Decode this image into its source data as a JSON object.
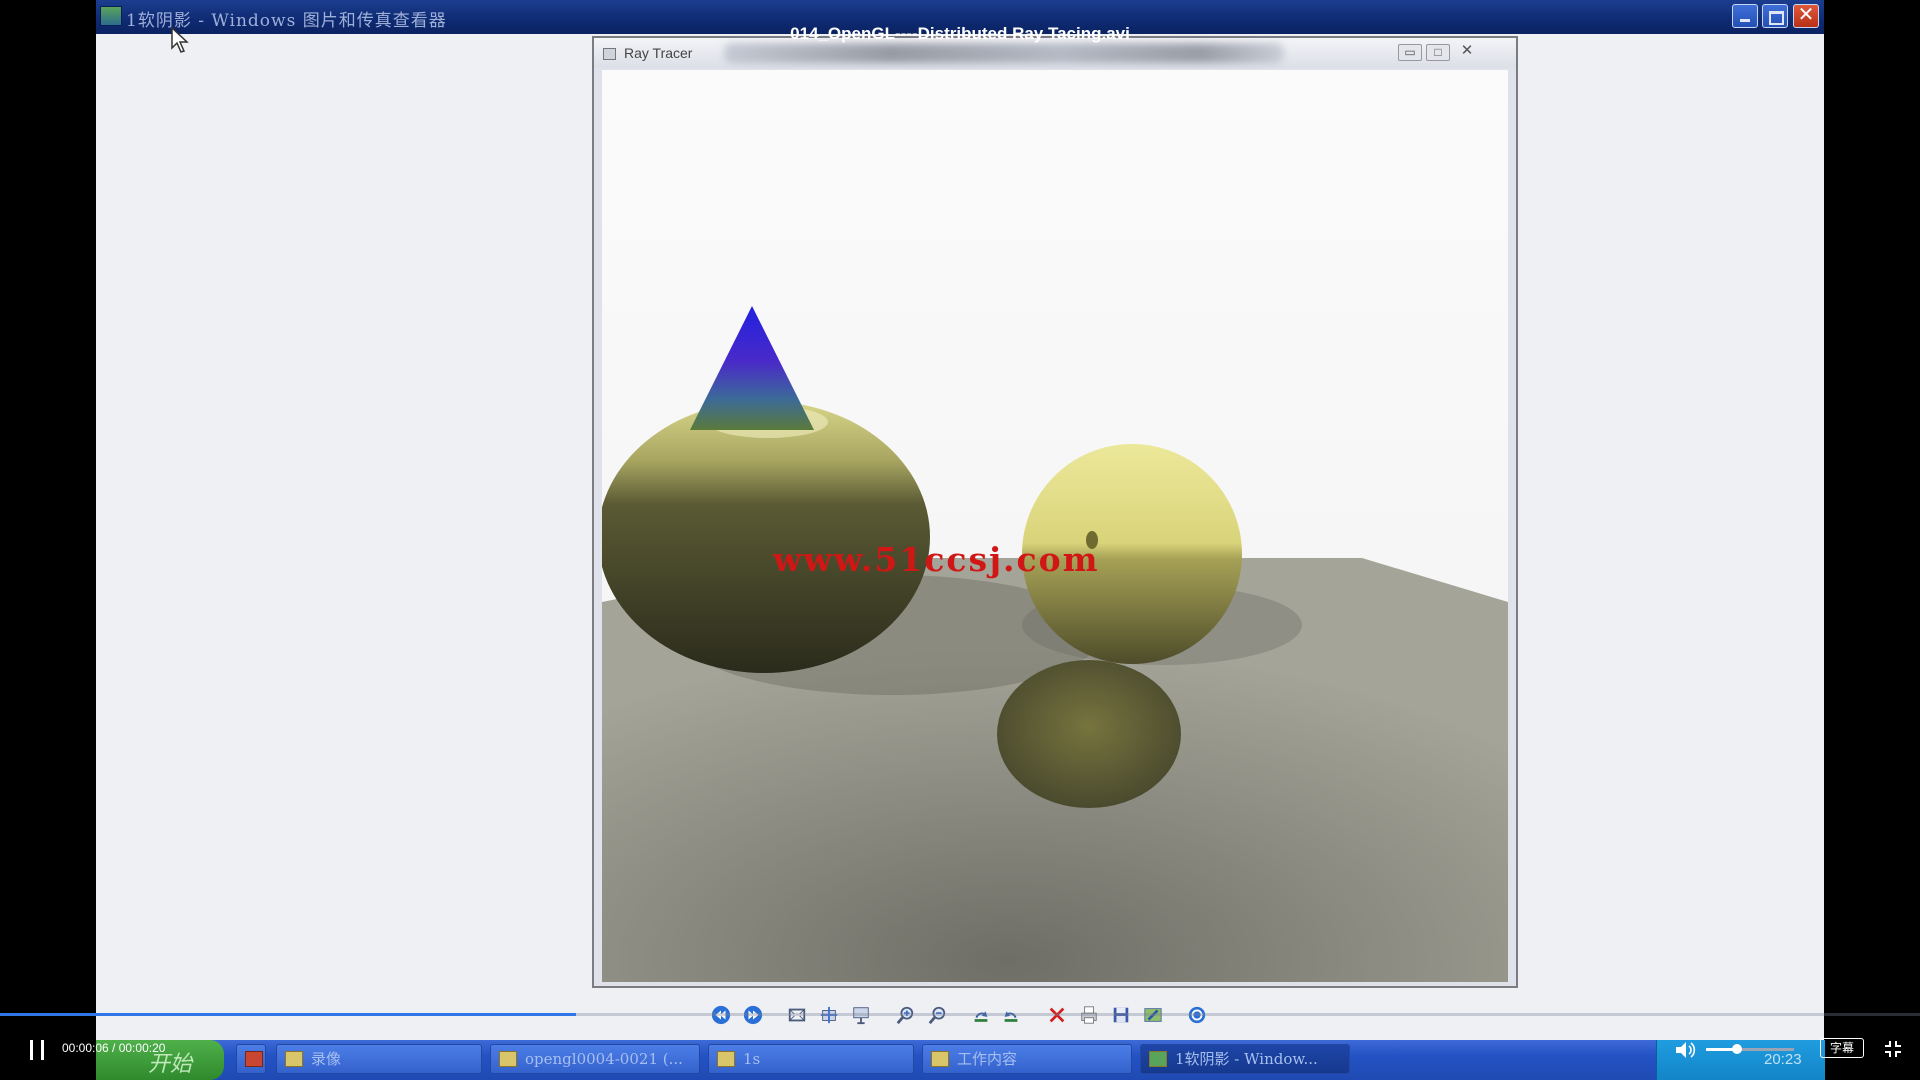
{
  "window": {
    "title": "1软阴影 - Windows 图片和传真查看器"
  },
  "video": {
    "title": "014_OpenGL----Distributed Ray Tacing.avi",
    "current_time": "00:00:06",
    "duration": "00:00:20",
    "time_display": "00:00:06 / 00:00:20",
    "progress": 0.3,
    "volume": 0.35,
    "subtitle_label": "字幕"
  },
  "raytracer": {
    "title": "Ray Tracer",
    "watermark": "www.51ccsj.com",
    "colors": {
      "sky": "#fafafa",
      "floor": "#9a9a8e",
      "sphere": "#e0dc78",
      "cone_top": "#2a2ad8"
    }
  },
  "viewer_toolbar": [
    "previous-icon",
    "next-icon",
    "best-fit-icon",
    "actual-size-icon",
    "slideshow-icon",
    "zoom-in-icon",
    "zoom-out-icon",
    "rotate-clockwise-icon",
    "rotate-counterclockwise-icon",
    "delete-icon",
    "print-icon",
    "save-icon",
    "edit-icon",
    "help-icon"
  ],
  "taskbar": {
    "start_label": "开始",
    "items": [
      {
        "label": "录像"
      },
      {
        "label": "opengl0004-0021 (..."
      },
      {
        "label": "1s"
      },
      {
        "label": "工作内容"
      },
      {
        "label": "1软阴影 - Window..."
      }
    ],
    "clock": "20:23"
  }
}
